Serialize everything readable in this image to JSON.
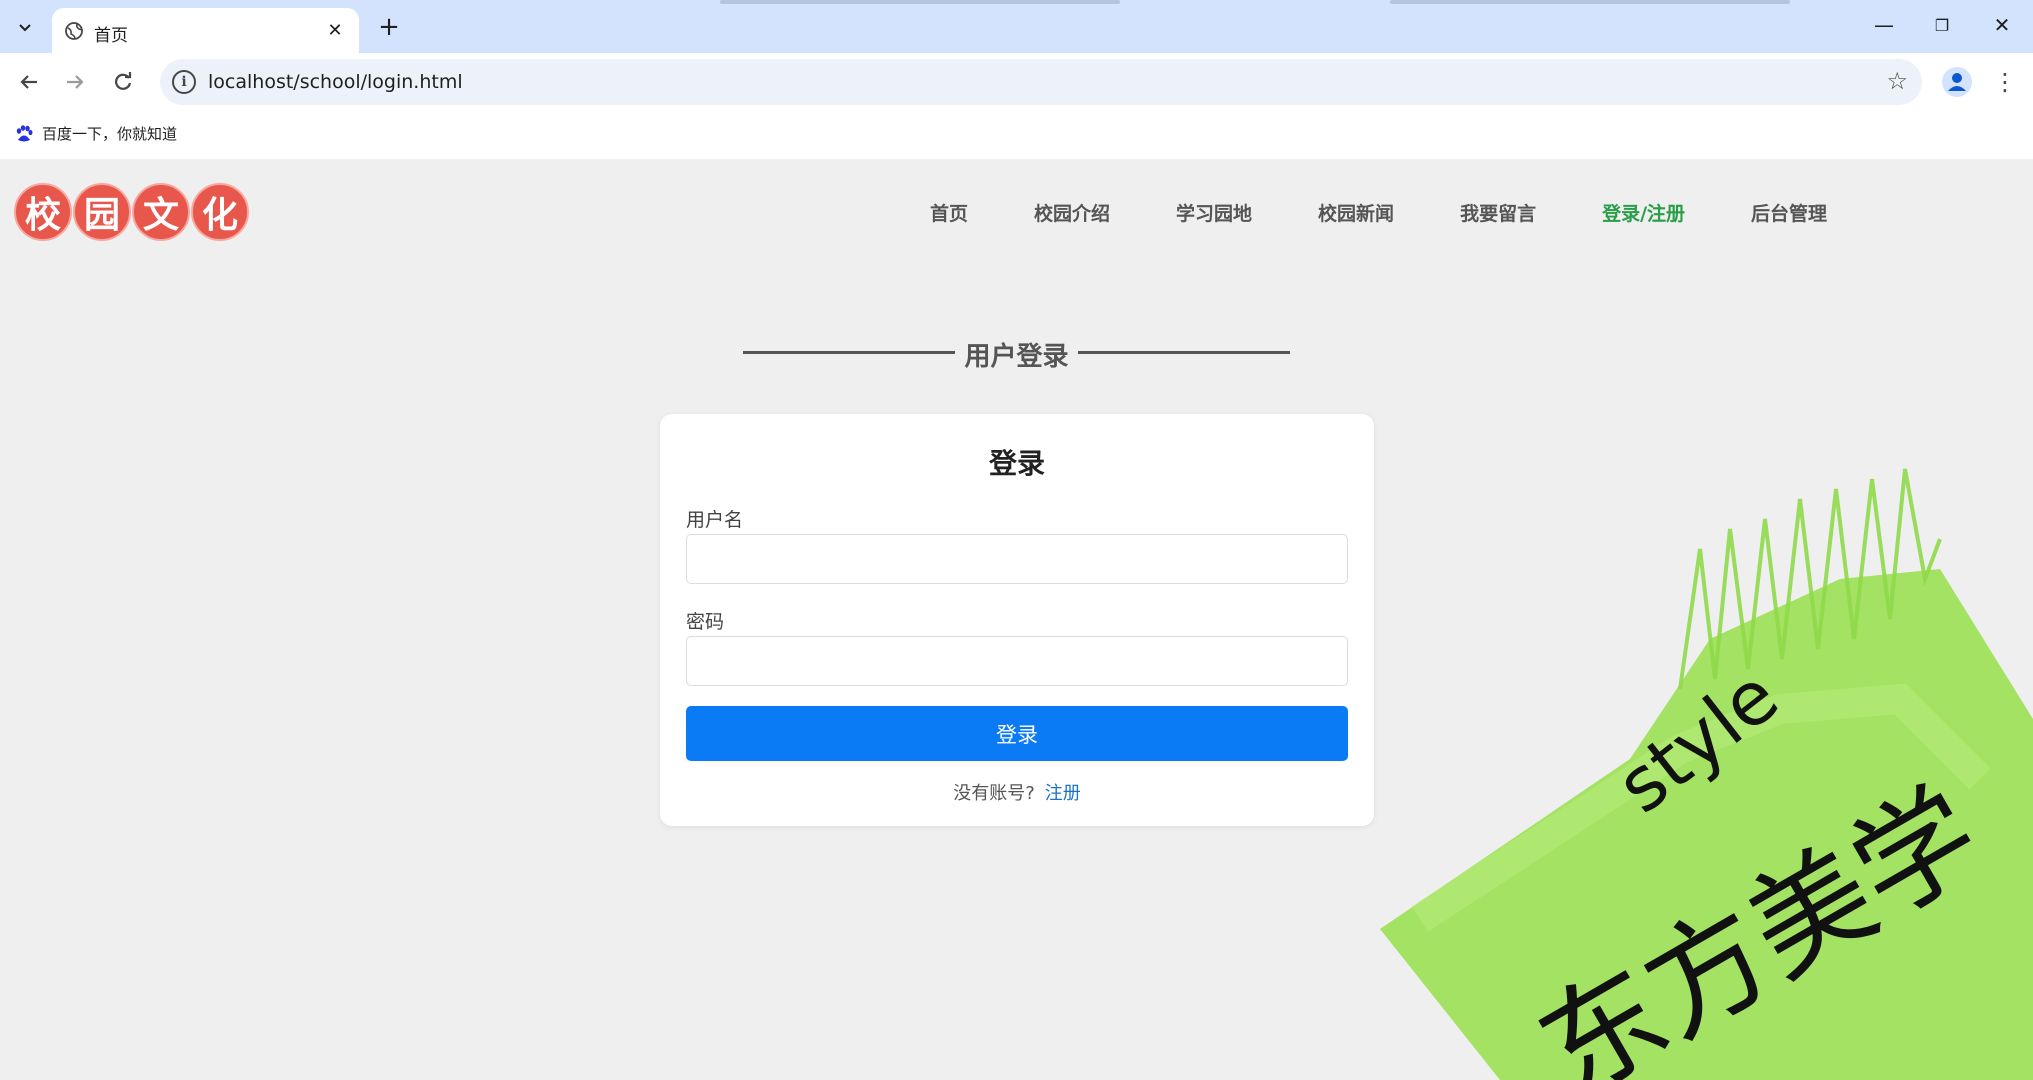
{
  "browser": {
    "tab_title": "首页",
    "url": "localhost/school/login.html",
    "bookmark_label": "百度一下，你就知道"
  },
  "site": {
    "logo_chars": [
      "校",
      "园",
      "文",
      "化"
    ],
    "nav": [
      "首页",
      "校园介绍",
      "学习园地",
      "校园新闻",
      "我要留言",
      "登录/注册",
      "后台管理"
    ],
    "active_nav": "登录/注册"
  },
  "login": {
    "section_title": "用户登录",
    "card_title": "登录",
    "username_label": "用户名",
    "password_label": "密码",
    "submit_label": "登录",
    "no_account_text": "没有账号?",
    "register_link": "注册"
  },
  "sticker": {
    "text_latin": "style",
    "text_cn": "东方美学"
  },
  "colors": {
    "tabbar": "#d3e3fd",
    "accent_button": "#0a7bf5",
    "active_nav": "#2a9d4a",
    "logo_circle": "#e8574b",
    "sticker_green": "#9ee05a"
  }
}
